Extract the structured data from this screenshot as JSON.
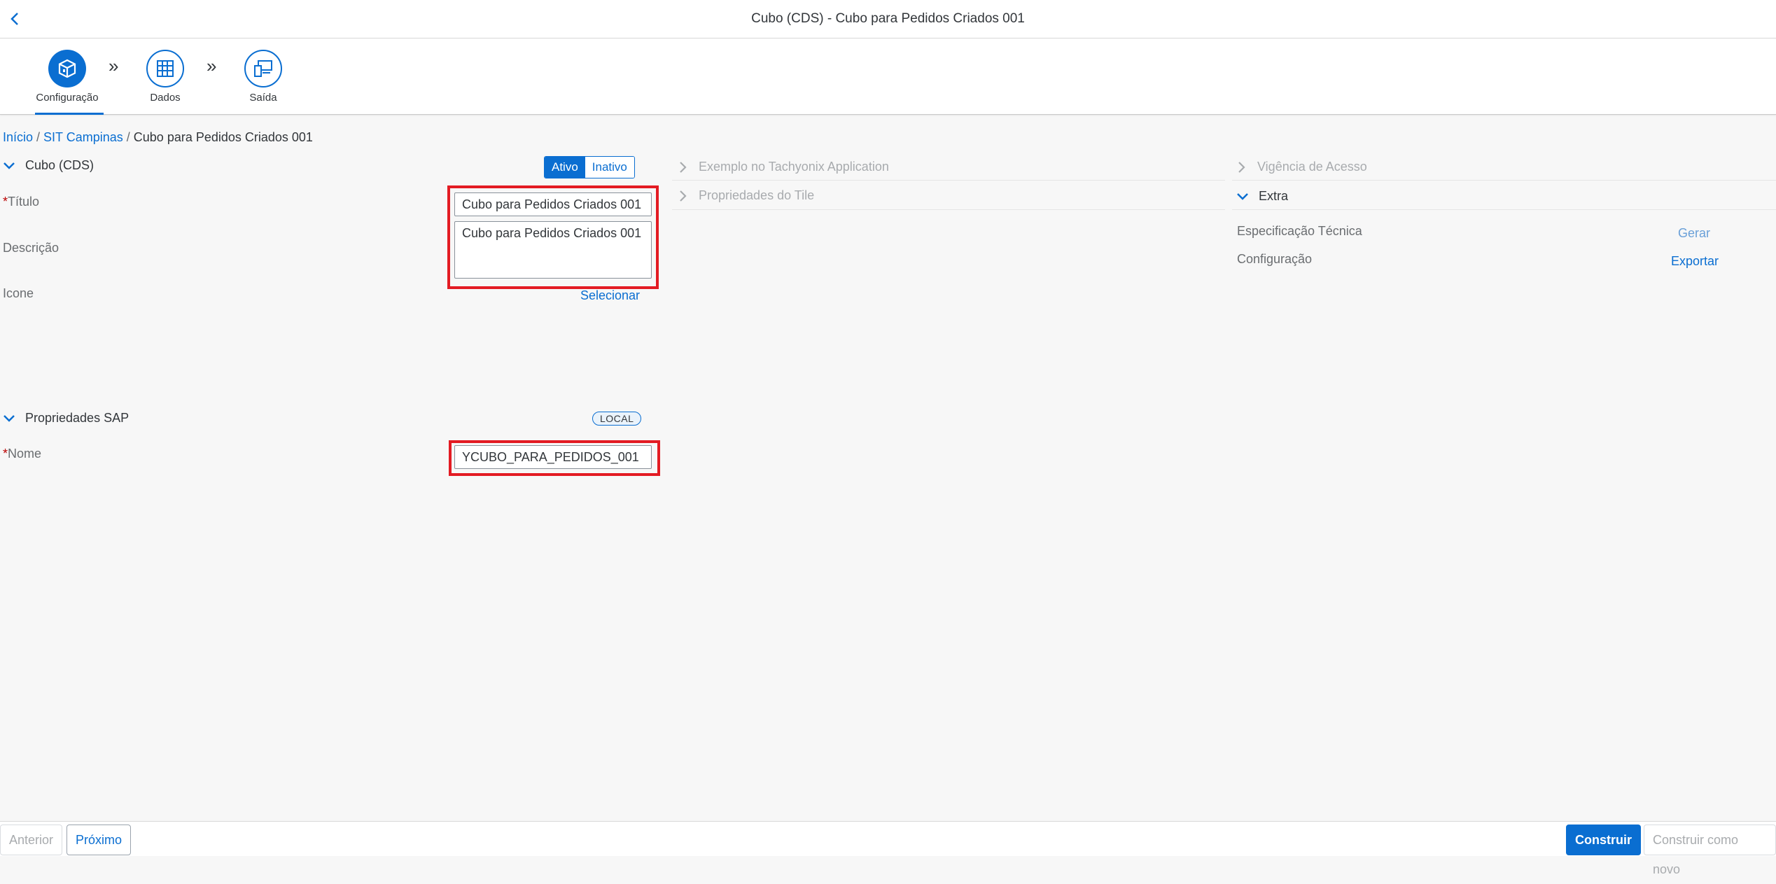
{
  "header": {
    "title": "Cubo (CDS) - Cubo para Pedidos Criados 001"
  },
  "wizard": {
    "steps": [
      {
        "label": "Configuração",
        "icon": "cube-icon",
        "active": true
      },
      {
        "label": "Dados",
        "icon": "table-grid-icon",
        "active": false
      },
      {
        "label": "Saída",
        "icon": "devices-icon",
        "active": false
      }
    ],
    "separator": "»"
  },
  "breadcrumb": {
    "home": "Início",
    "parent": "SIT Campinas",
    "current": "Cubo para Pedidos Criados 001",
    "sep": "/"
  },
  "cube_section": {
    "title": "Cubo (CDS)",
    "toggle": {
      "on_label": "Ativo",
      "off_label": "Inativo",
      "selected": "Ativo"
    },
    "fields": {
      "title_label": "Título",
      "title_value": "Cubo para Pedidos Criados 001",
      "description_label": "Descrição",
      "description_value": "Cubo para Pedidos Criados 001",
      "icon_label": "Icone",
      "icon_action": "Selecionar"
    }
  },
  "sap_section": {
    "title": "Propriedades SAP",
    "badge": "LOCAL",
    "name_label": "Nome",
    "name_value": "YCUBO_PARA_PEDIDOS_001"
  },
  "middle_panels": {
    "example": "Exemplo no Tachyonix Application",
    "tile_props": "Propriedades do Tile"
  },
  "right_panels": {
    "access": "Vigência de Acesso",
    "extra": {
      "title": "Extra",
      "rows": [
        {
          "label": "Especificação Técnica",
          "action": "Gerar",
          "enabled": false
        },
        {
          "label": "Configuração",
          "action": "Exportar",
          "enabled": true
        }
      ]
    }
  },
  "footer": {
    "prev": "Anterior",
    "next": "Próximo",
    "build": "Construir",
    "build_new": "Construir como novo"
  },
  "required_mark": "*",
  "colors": {
    "accent": "#0a6ed1",
    "highlight": "#e31b23",
    "required": "#bb0000"
  }
}
